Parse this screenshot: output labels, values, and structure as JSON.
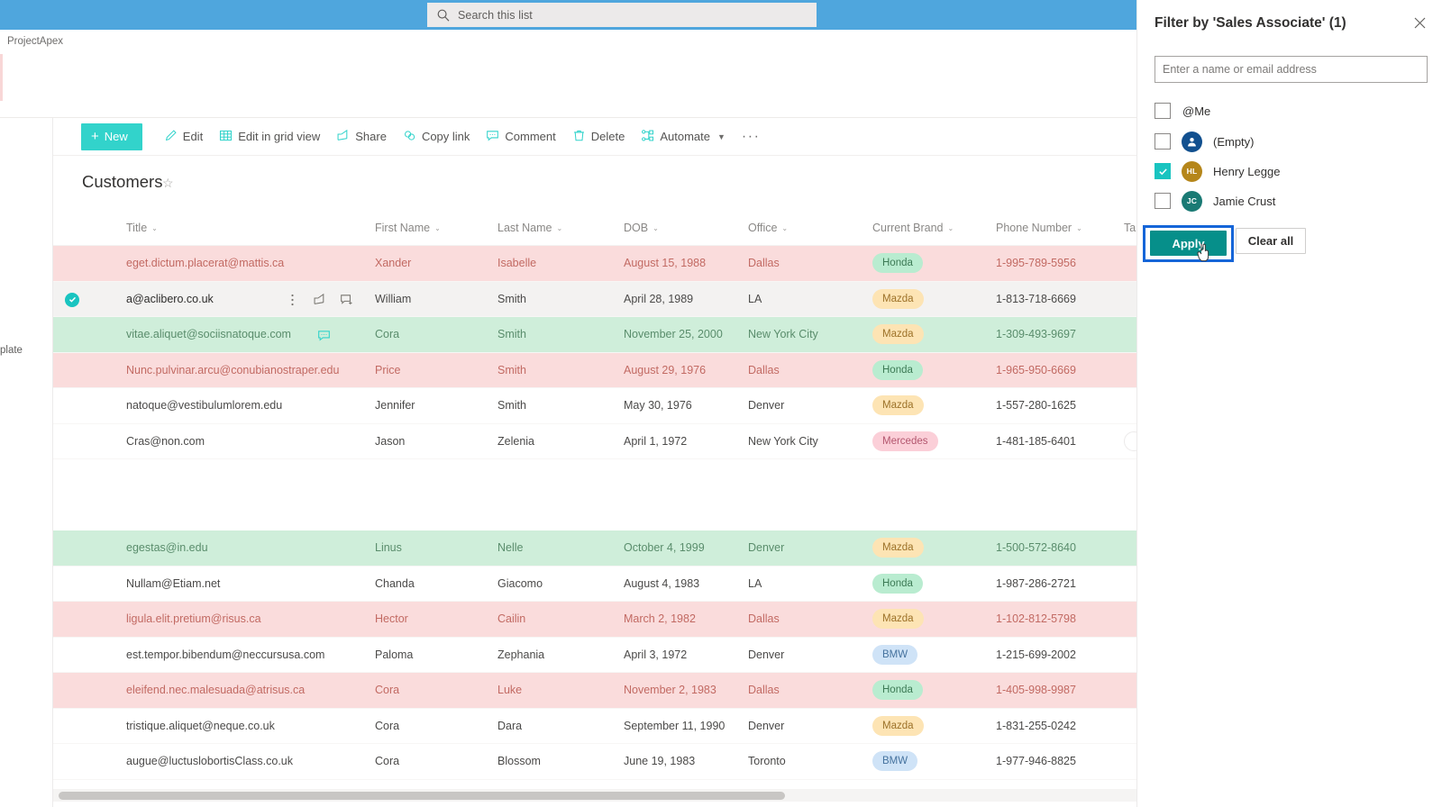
{
  "suite": {
    "search": {
      "placeholder": "Search this list",
      "icon": "search-icon"
    }
  },
  "site": {
    "name": "ProjectApex"
  },
  "left_rail": {
    "clipped_label": "plate"
  },
  "toolbar": {
    "new_label": "New",
    "items": [
      {
        "label": "Edit",
        "icon": "pencil-icon"
      },
      {
        "label": "Edit in grid view",
        "icon": "grid-icon"
      },
      {
        "label": "Share",
        "icon": "share-icon"
      },
      {
        "label": "Copy link",
        "icon": "link-icon"
      },
      {
        "label": "Comment",
        "icon": "comment-icon"
      },
      {
        "label": "Delete",
        "icon": "trash-icon"
      },
      {
        "label": "Automate",
        "icon": "automate-icon",
        "chevron": true
      }
    ],
    "overflow_label": "···"
  },
  "list": {
    "title": "Customers",
    "favorite_icon": "star-icon"
  },
  "table": {
    "columns": [
      {
        "key": "title",
        "label": "Title"
      },
      {
        "key": "first",
        "label": "First Name"
      },
      {
        "key": "last",
        "label": "Last Name"
      },
      {
        "key": "dob",
        "label": "DOB"
      },
      {
        "key": "office",
        "label": "Office"
      },
      {
        "key": "brand",
        "label": "Current Brand"
      },
      {
        "key": "phone",
        "label": "Phone Number"
      },
      {
        "key": "clipped",
        "label": "Ta"
      }
    ],
    "rows": [
      {
        "title": "eget.dictum.placerat@mattis.ca",
        "first": "Xander",
        "last": "Isabelle",
        "dob": "August 15, 1988",
        "office": "Dallas",
        "brand": "Honda",
        "phone": "1-995-789-5956",
        "state": "pink"
      },
      {
        "title": "a@aclibero.co.uk",
        "first": "William",
        "last": "Smith",
        "dob": "April 28, 1989",
        "office": "LA",
        "brand": "Mazda",
        "phone": "1-813-718-6669",
        "state": "sel",
        "selected": true,
        "hover_icons": true
      },
      {
        "title": "vitae.aliquet@sociisnatoque.com",
        "first": "Cora",
        "last": "Smith",
        "dob": "November 25, 2000",
        "office": "New York City",
        "brand": "Mazda",
        "phone": "1-309-493-9697",
        "state": "green",
        "comment_icon": true
      },
      {
        "title": "Nunc.pulvinar.arcu@conubianostraper.edu",
        "first": "Price",
        "last": "Smith",
        "dob": "August 29, 1976",
        "office": "Dallas",
        "brand": "Honda",
        "phone": "1-965-950-6669",
        "state": "pink"
      },
      {
        "title": "natoque@vestibulumlorem.edu",
        "first": "Jennifer",
        "last": "Smith",
        "dob": "May 30, 1976",
        "office": "Denver",
        "brand": "Mazda",
        "phone": "1-557-280-1625",
        "state": "plain"
      },
      {
        "title": "Cras@non.com",
        "first": "Jason",
        "last": "Zelenia",
        "dob": "April 1, 1972",
        "office": "New York City",
        "brand": "Mercedes",
        "phone": "1-481-185-6401",
        "state": "plain"
      },
      {
        "title": "",
        "first": "",
        "last": "",
        "dob": "",
        "office": "",
        "brand": "",
        "phone": "",
        "state": "spacer"
      },
      {
        "title": "egestas@in.edu",
        "first": "Linus",
        "last": "Nelle",
        "dob": "October 4, 1999",
        "office": "Denver",
        "brand": "Mazda",
        "phone": "1-500-572-8640",
        "state": "green"
      },
      {
        "title": "Nullam@Etiam.net",
        "first": "Chanda",
        "last": "Giacomo",
        "dob": "August 4, 1983",
        "office": "LA",
        "brand": "Honda",
        "phone": "1-987-286-2721",
        "state": "plain"
      },
      {
        "title": "ligula.elit.pretium@risus.ca",
        "first": "Hector",
        "last": "Cailin",
        "dob": "March 2, 1982",
        "office": "Dallas",
        "brand": "Mazda",
        "phone": "1-102-812-5798",
        "state": "pink"
      },
      {
        "title": "est.tempor.bibendum@neccursusa.com",
        "first": "Paloma",
        "last": "Zephania",
        "dob": "April 3, 1972",
        "office": "Denver",
        "brand": "BMW",
        "phone": "1-215-699-2002",
        "state": "plain"
      },
      {
        "title": "eleifend.nec.malesuada@atrisus.ca",
        "first": "Cora",
        "last": "Luke",
        "dob": "November 2, 1983",
        "office": "Dallas",
        "brand": "Honda",
        "phone": "1-405-998-9987",
        "state": "pink"
      },
      {
        "title": "tristique.aliquet@neque.co.uk",
        "first": "Cora",
        "last": "Dara",
        "dob": "September 11, 1990",
        "office": "Denver",
        "brand": "Mazda",
        "phone": "1-831-255-0242",
        "state": "plain"
      },
      {
        "title": "augue@luctuslobortisClass.co.uk",
        "first": "Cora",
        "last": "Blossom",
        "dob": "June 19, 1983",
        "office": "Toronto",
        "brand": "BMW",
        "phone": "1-977-946-8825",
        "state": "plain"
      }
    ]
  },
  "filter_panel": {
    "title": "Filter by 'Sales Associate' (1)",
    "close_icon": "close-icon",
    "input_placeholder": "Enter a name or email address",
    "input_value": "",
    "options": [
      {
        "label": "@Me",
        "checked": false,
        "avatar": null
      },
      {
        "label": "(Empty)",
        "checked": false,
        "avatar": {
          "initials": "",
          "color": "#12508f",
          "icon": "person-icon"
        }
      },
      {
        "label": "Henry Legge",
        "checked": true,
        "avatar": {
          "initials": "HL",
          "color": "#b5861a"
        }
      },
      {
        "label": "Jamie Crust",
        "checked": false,
        "avatar": {
          "initials": "JC",
          "color": "#1a7a74"
        }
      }
    ],
    "apply_label": "Apply",
    "clear_label": "Clear all"
  },
  "colors": {
    "suite_bar": "#4fa6dd",
    "accent_teal": "#32d3cb",
    "apply_teal": "#068f8a",
    "focus_blue": "#1565d8",
    "row_pink": "#fadcdc",
    "row_green": "#cfeeda",
    "pill_honda": "#b9ecd0",
    "pill_mazda": "#fde4b4",
    "pill_mercedes": "#fbcfd8",
    "pill_bmw": "#cfe3f7"
  }
}
